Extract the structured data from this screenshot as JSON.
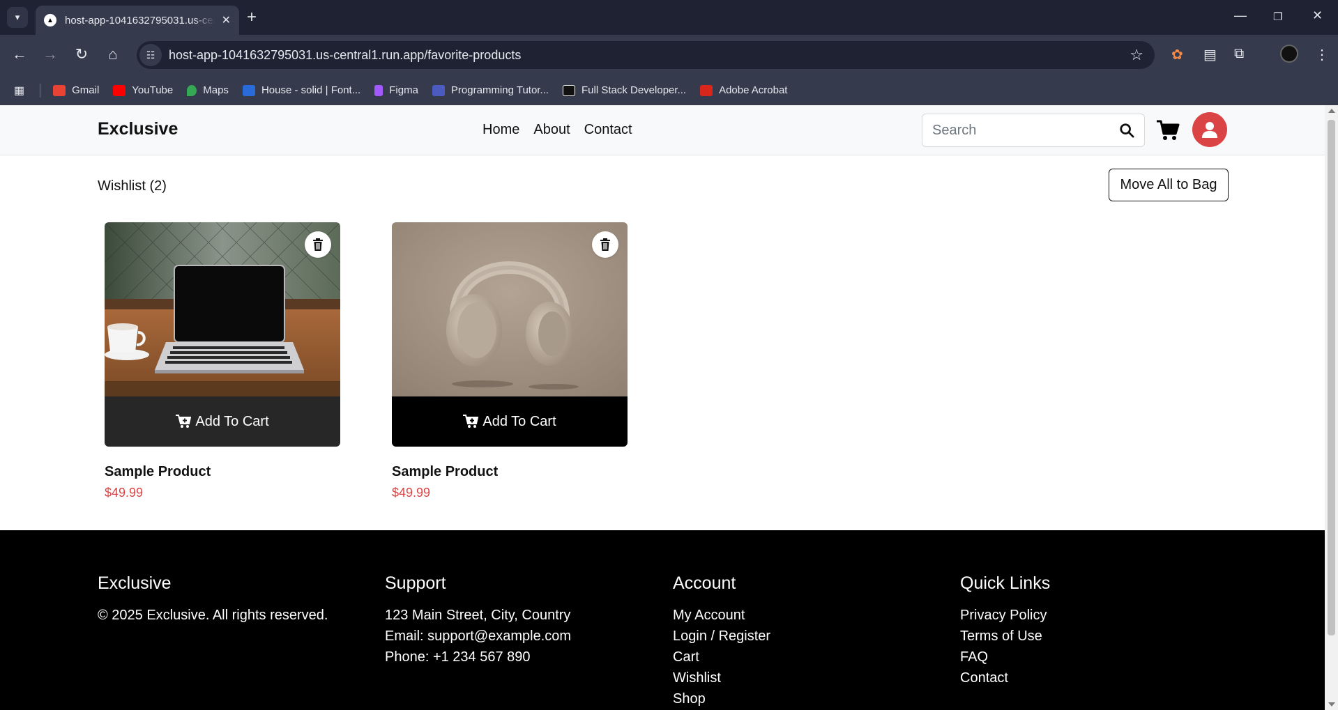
{
  "browser": {
    "tab_title": "host-app-1041632795031.us-central1.run.app",
    "url": "host-app-1041632795031.us-central1.run.app/favorite-products",
    "bookmarks": [
      {
        "label": "Gmail",
        "color": "#ea4335"
      },
      {
        "label": "YouTube",
        "color": "#ff0000"
      },
      {
        "label": "Maps",
        "color": "#34a853"
      },
      {
        "label": "House - solid | Font...",
        "color": "#2b6bd9"
      },
      {
        "label": "Figma",
        "color": "#a259ff"
      },
      {
        "label": "Programming Tutor...",
        "color": "#4b5bbf"
      },
      {
        "label": "Full Stack Developer...",
        "color": "#111111"
      },
      {
        "label": "Adobe Acrobat",
        "color": "#d9261c"
      }
    ]
  },
  "header": {
    "logo": "Exclusive",
    "nav": [
      "Home",
      "About",
      "Contact"
    ],
    "search_placeholder": "Search"
  },
  "wishlist": {
    "title": "Wishlist (2)",
    "move_all_label": "Move All to Bag"
  },
  "products": [
    {
      "name": "Sample Product",
      "price": "$49.99",
      "add_to_cart": "Add To Cart",
      "image": "laptop-on-cafe-table"
    },
    {
      "name": "Sample Product",
      "price": "$49.99",
      "add_to_cart": "Add To Cart",
      "image": "beige-headphones"
    }
  ],
  "footer": {
    "columns": [
      {
        "title": "Exclusive",
        "lines": [
          "© 2025 Exclusive. All rights reserved."
        ]
      },
      {
        "title": "Support",
        "lines": [
          "123 Main Street, City, Country",
          "Email: support@example.com",
          "Phone: +1 234 567 890"
        ]
      },
      {
        "title": "Account",
        "lines": [
          "My Account",
          "Login / Register",
          "Cart",
          "Wishlist",
          "Shop"
        ]
      },
      {
        "title": "Quick Links",
        "lines": [
          "Privacy Policy",
          "Terms of Use",
          "FAQ",
          "Contact"
        ]
      }
    ]
  },
  "colors": {
    "accent": "#db4444",
    "chrome_dark": "#1e2233",
    "chrome": "#353a4d"
  }
}
